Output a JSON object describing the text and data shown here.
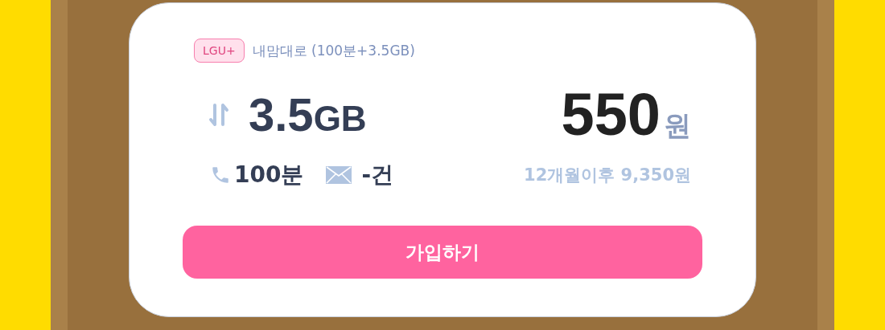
{
  "plan": {
    "carrier": "LGU+",
    "name": "내맘대로 (100분+3.5GB)",
    "data_amount": "3.5",
    "data_unit": "GB",
    "price": "550",
    "price_unit": "원",
    "voice": "100분",
    "sms": "-건",
    "later_price": "12개월이후 9,350원",
    "button": "가입하기"
  }
}
